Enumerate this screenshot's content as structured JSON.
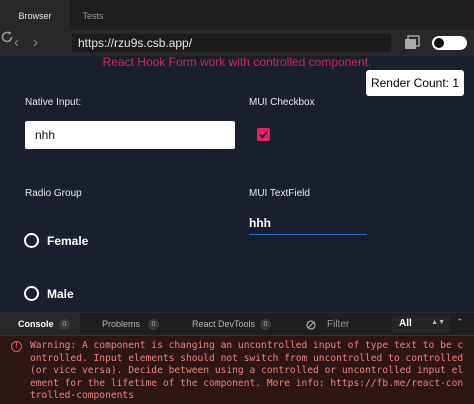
{
  "tabs": [
    {
      "label": "Browser"
    },
    {
      "label": "Tests"
    }
  ],
  "address": {
    "url": "https://rzu9s.csb.app/"
  },
  "app": {
    "header": "React Hook Form work with controlled component.",
    "render_count": "Render Count: 1",
    "native_input": {
      "label": "Native Input:",
      "value": "nhh"
    },
    "checkbox": {
      "label": "MUI Checkbox",
      "checked": true
    },
    "radio_group": {
      "label": "Radio Group",
      "options": [
        "Female",
        "Male"
      ]
    },
    "textfield": {
      "label": "MUI TextField",
      "value": "hhh"
    }
  },
  "console": {
    "tabs": [
      {
        "label": "Console",
        "count": "0"
      },
      {
        "label": "Problems",
        "count": "0"
      },
      {
        "label": "React DevTools",
        "count": "0"
      }
    ],
    "filter_placeholder": "Filter",
    "level": "All",
    "warning": "Warning: A component is changing an uncontrolled input of type text to be controlled. Input elements should not switch from uncontrolled to controlled (or vice versa). Decide between using a controlled or uncontrolled input element for the lifetime of the component. More info: https://fb.me/react-controlled-components"
  },
  "colors": {
    "accent_pink": "#e91e63",
    "header_text": "#c92b5a",
    "focus_blue": "#2f6fd8",
    "warning_text": "#f08080"
  }
}
